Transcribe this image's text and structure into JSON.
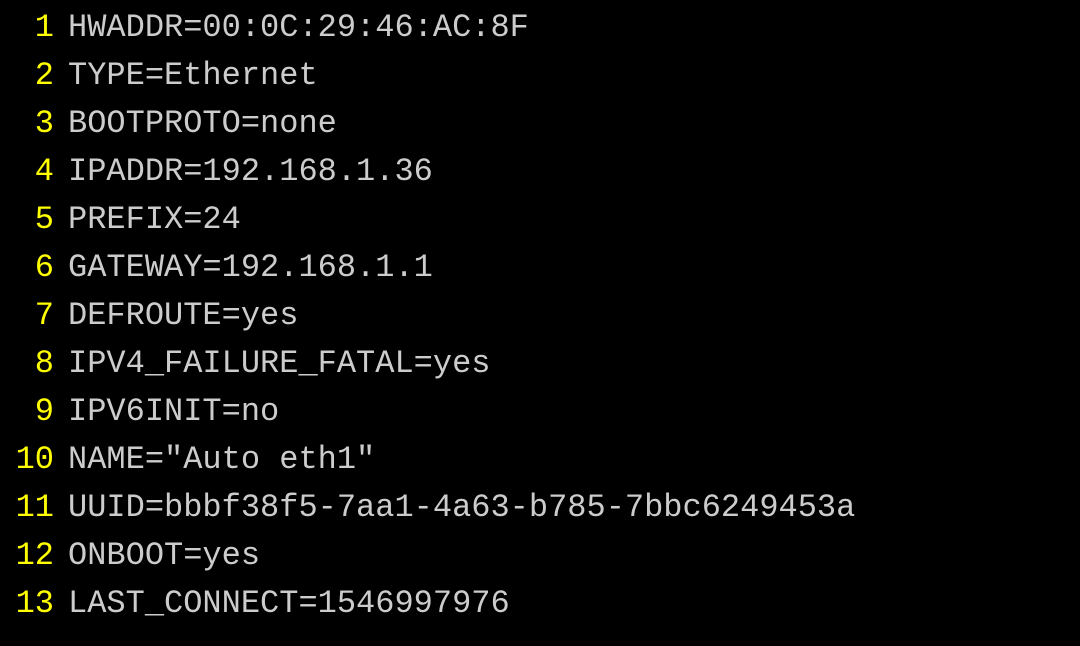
{
  "editor": {
    "lines": [
      {
        "n": "1",
        "text": "HWADDR=00:0C:29:46:AC:8F"
      },
      {
        "n": "2",
        "text": "TYPE=Ethernet"
      },
      {
        "n": "3",
        "text": "BOOTPROTO=none"
      },
      {
        "n": "4",
        "text": "IPADDR=192.168.1.36"
      },
      {
        "n": "5",
        "text": "PREFIX=24"
      },
      {
        "n": "6",
        "text": "GATEWAY=192.168.1.1"
      },
      {
        "n": "7",
        "text": "DEFROUTE=yes"
      },
      {
        "n": "8",
        "text": "IPV4_FAILURE_FATAL=yes"
      },
      {
        "n": "9",
        "text": "IPV6INIT=no"
      },
      {
        "n": "10",
        "text": "NAME=\"Auto eth1\""
      },
      {
        "n": "11",
        "text": "UUID=bbbf38f5-7aa1-4a63-b785-7bbc6249453a"
      },
      {
        "n": "12",
        "text": "ONBOOT=yes"
      },
      {
        "n": "13",
        "text": "LAST_CONNECT=1546997976"
      }
    ]
  }
}
